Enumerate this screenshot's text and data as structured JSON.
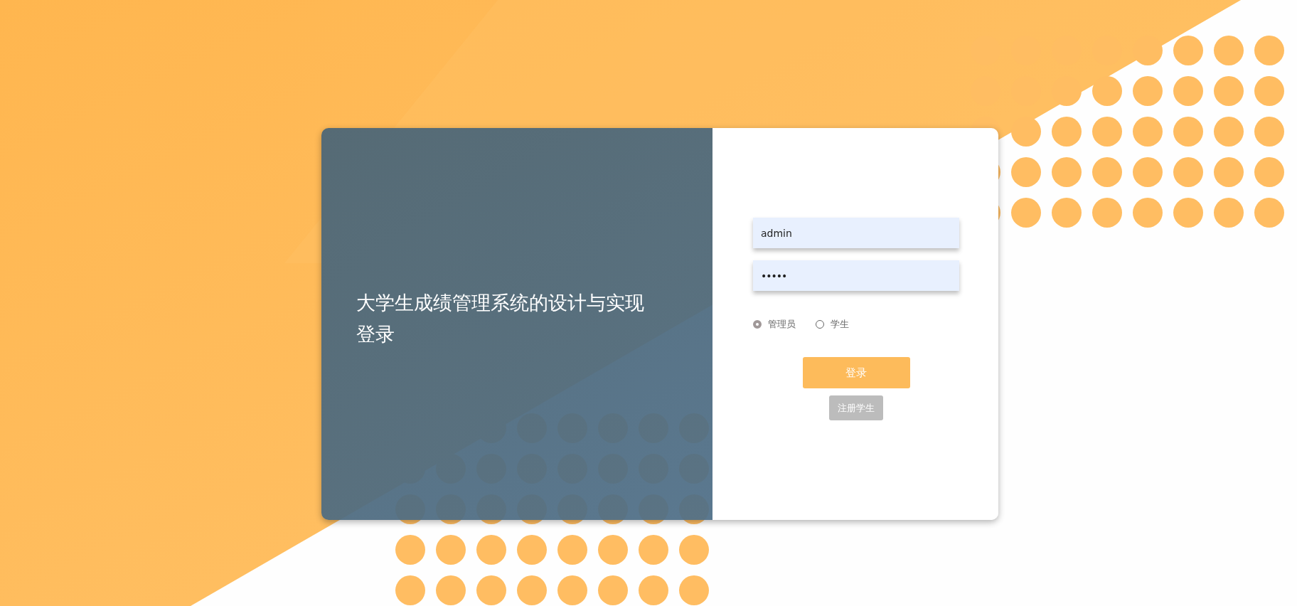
{
  "title_lines": [
    "大学生成绩管理系统的设计与实现",
    "登录"
  ],
  "fields": [
    {
      "kind": "text",
      "value": "admin"
    },
    {
      "kind": "password",
      "value": "•••••"
    }
  ],
  "roles": [
    {
      "label": "管理员",
      "selected": true
    },
    {
      "label": "学生",
      "selected": false
    }
  ],
  "buttons": [
    {
      "kind": "primary",
      "label": "登录"
    },
    {
      "kind": "secondary",
      "label": "注册学生"
    }
  ]
}
